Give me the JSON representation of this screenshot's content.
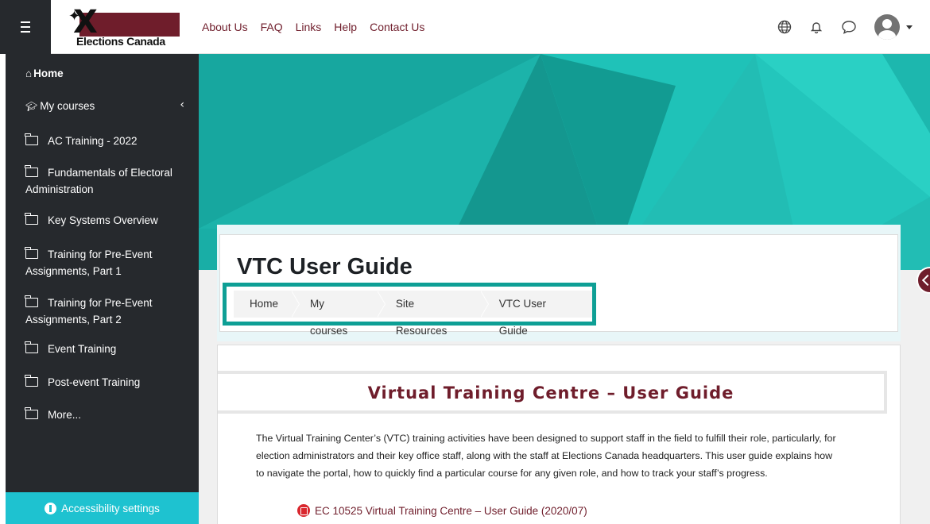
{
  "brand": {
    "name": "Elections Canada"
  },
  "topnav": {
    "links": [
      "About Us",
      "FAQ",
      "Links",
      "Help",
      "Contact Us"
    ]
  },
  "sidebar": {
    "home": "Home",
    "my_courses": "My courses",
    "courses": [
      "AC Training - 2022",
      "Fundamentals of Electoral Administration",
      "Key Systems Overview",
      "Training for Pre-Event Assignments, Part 1",
      "Training for Pre-Event Assignments, Part 2",
      "Event Training",
      "Post-event Training",
      "More..."
    ],
    "accessibility": "Accessibility settings"
  },
  "page": {
    "title": "VTC User Guide",
    "breadcrumb": [
      "Home",
      "My courses",
      "Site Resources",
      "VTC User Guide"
    ]
  },
  "content": {
    "section_title": "Virtual Training Centre – User Guide",
    "paragraph": "The Virtual Training Center’s (VTC) training activities have been designed to support staff in the field to fulfill their role, particularly, for election administrators and their key office staff, along with the staff at Elections Canada headquarters. This user guide explains how to navigate the portal, how to quickly find a particular course for any given role, and how to track your staff’s progress.",
    "pdf_link": "EC 10525 Virtual Training Centre – User Guide (2020/07)"
  },
  "colors": {
    "accent": "#6f1d2b",
    "teal": "#1ab8b0",
    "sidebar_bg": "#26292d",
    "access_bg": "#1ec2d0"
  }
}
